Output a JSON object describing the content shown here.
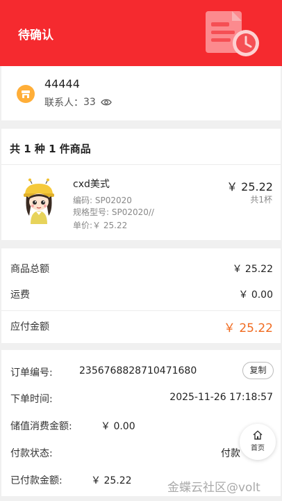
{
  "header": {
    "status": "待确认",
    "status_illustration_icon": "document-clock-icon",
    "color": "#f52a2f"
  },
  "contact": {
    "store_icon": "store-icon",
    "shop_name": "44444",
    "contact_label": "联系人：",
    "contact_value": "33",
    "eye_icon": "eye-icon"
  },
  "goods": {
    "summary": "共 1 种 1 件商品",
    "items": [
      {
        "name": "cxd美式",
        "code": "编码: SP02020",
        "spec": "规格型号: SP02020//",
        "unit_price": "单价:￥ 25.22",
        "price": "￥ 25.22",
        "quantity": "共1杯"
      }
    ]
  },
  "amounts": {
    "goods_total_label": "商品总额",
    "goods_total": "￥ 25.22",
    "shipping_label": "运费",
    "shipping": "￥ 0.00",
    "payable_label": "应付金额",
    "payable": "￥ 25.22",
    "payable_color": "#f06a1f"
  },
  "order": {
    "number_label": "订单编号:",
    "number": "2356768828710471680",
    "copy_label": "复制",
    "time_label": "下单时间:",
    "time": "2025-11-26 17:18:57",
    "stored_value_label": "储值消费金额:",
    "stored_value": "￥ 0.00",
    "payment_status_label": "付款状态:",
    "payment_status": "付款",
    "paid_amount_label": "已付款金额:",
    "paid_amount": "￥ 25.22"
  },
  "home_button": {
    "icon": "home-icon",
    "label": "首页"
  },
  "watermark": "金蝶云社区@volt"
}
